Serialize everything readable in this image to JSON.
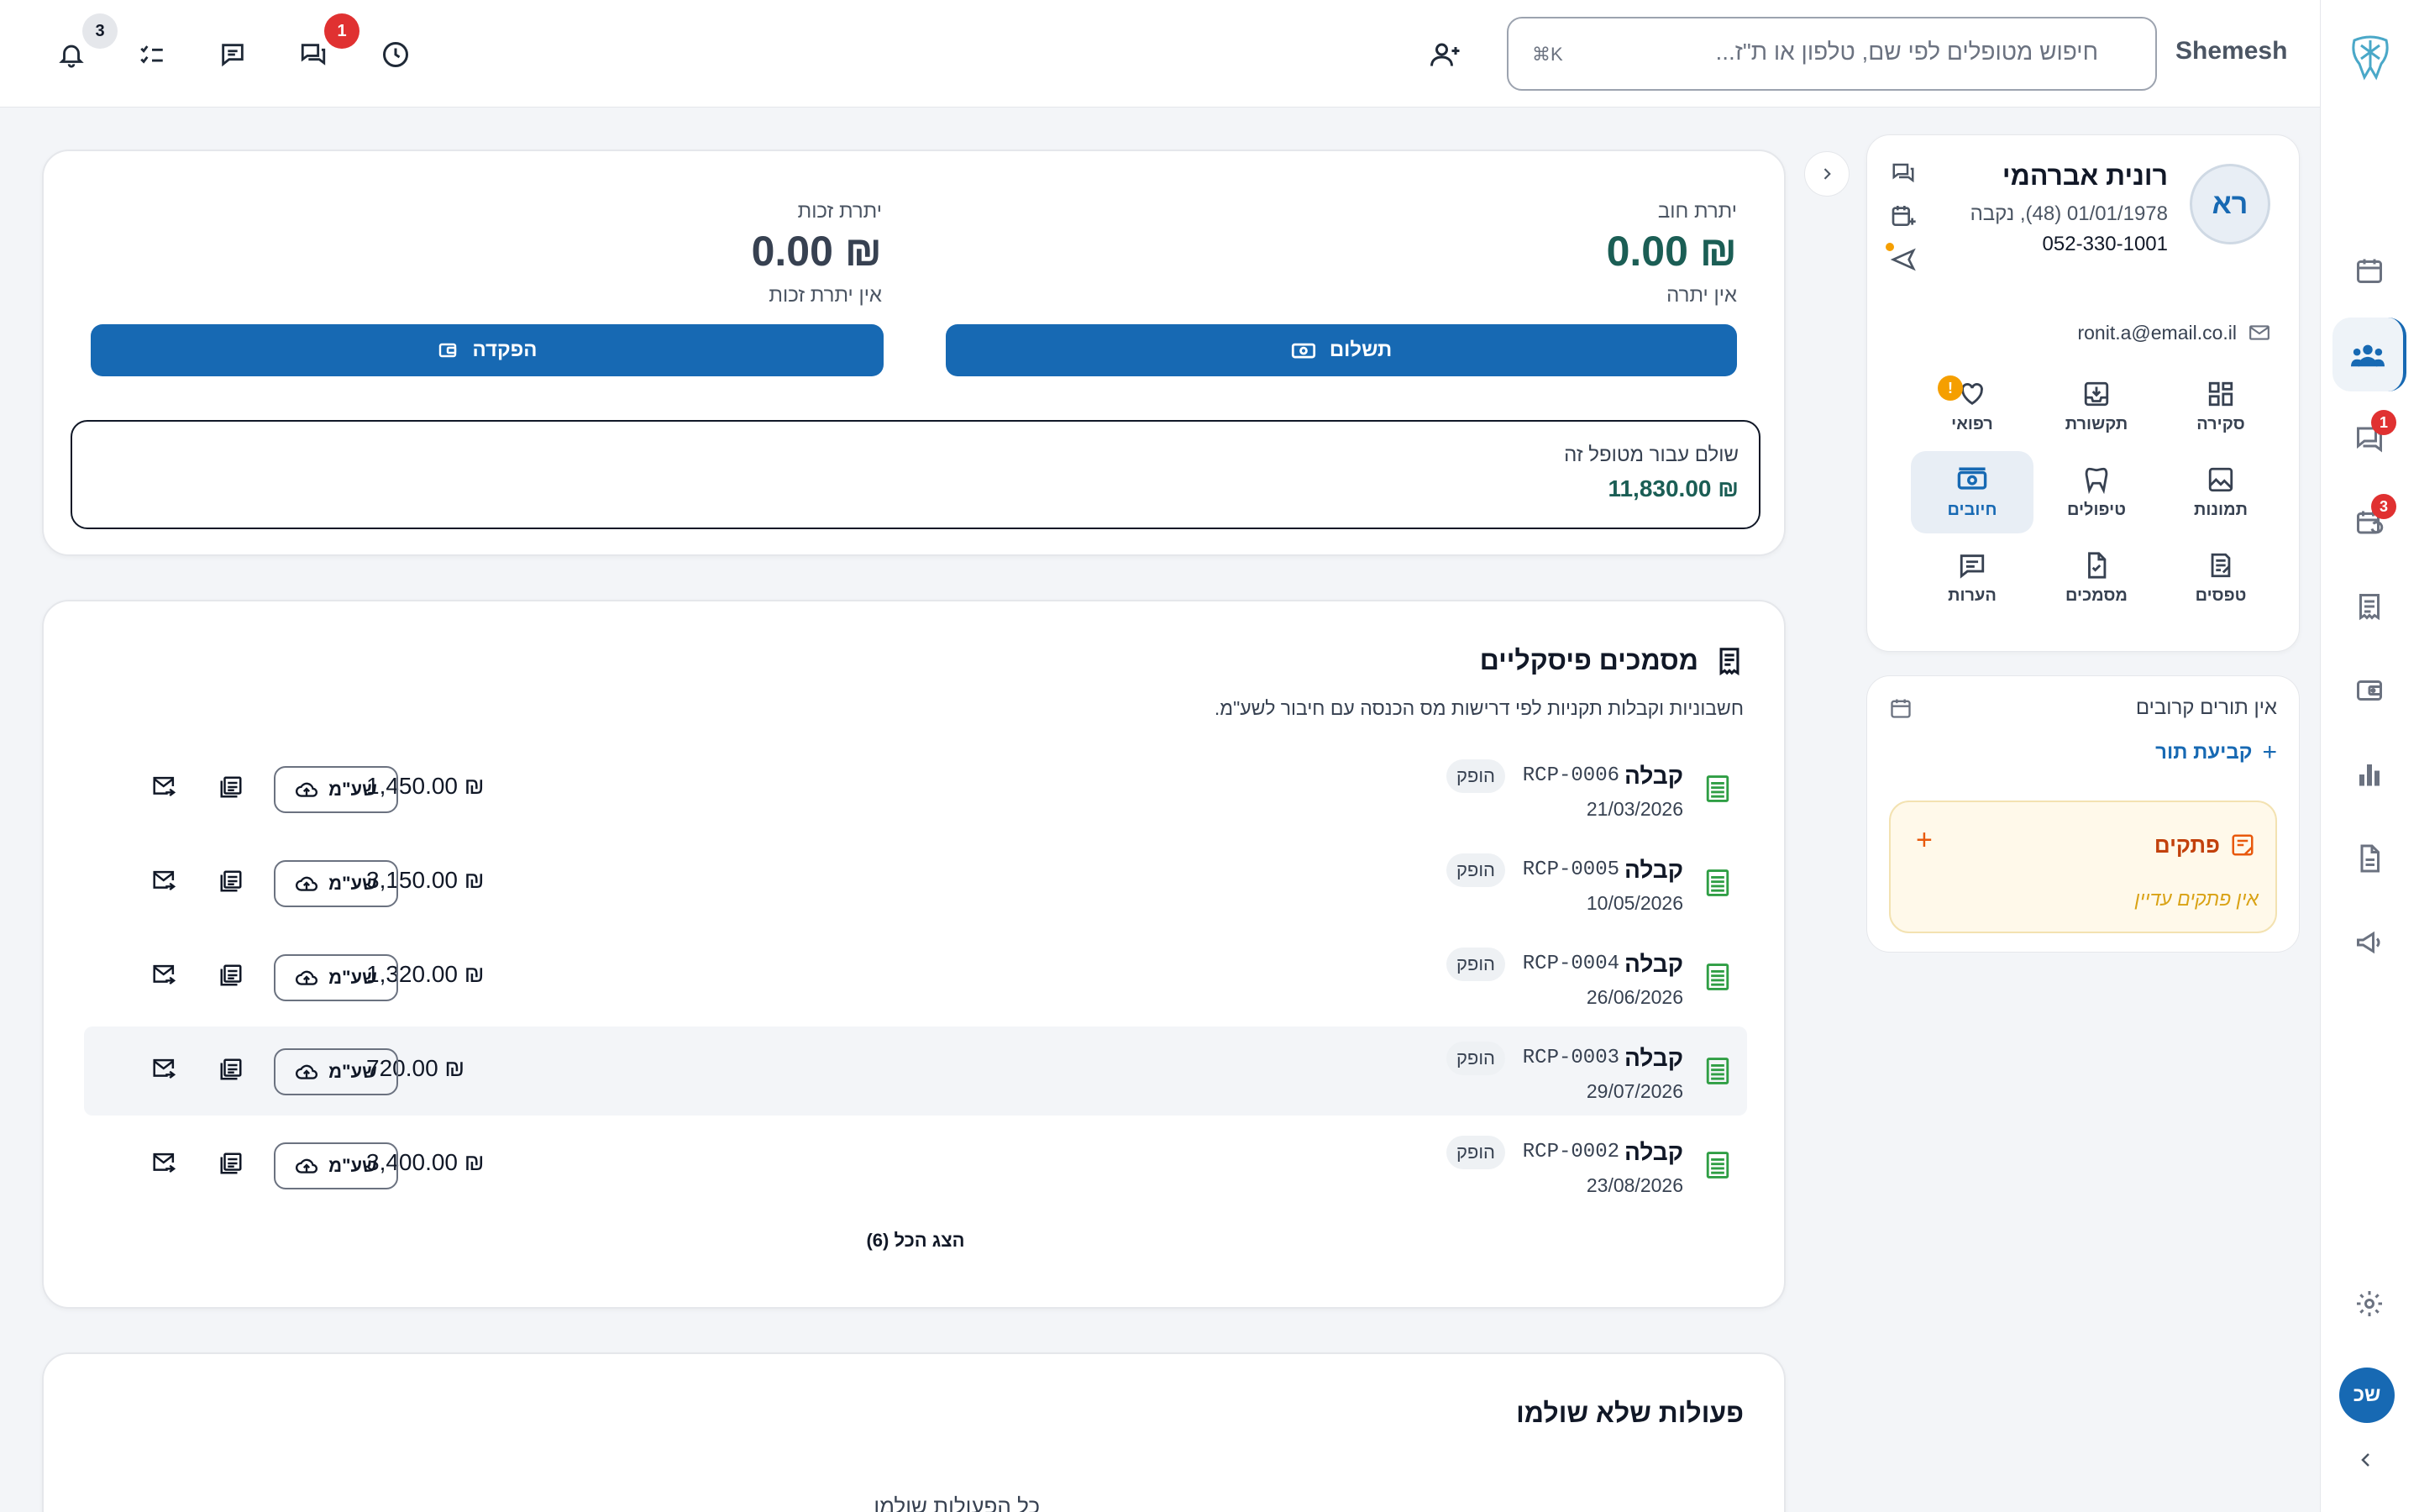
{
  "brand": {
    "name": "Shemesh"
  },
  "topbar": {
    "search_placeholder": "חיפוש מטופלים לפי שם, טלפון או ת\"ז...",
    "search_shortcut": "⌘K",
    "notifications_count": "3",
    "chat_count": "1"
  },
  "rail": {
    "messages_badge": "1",
    "recall_badge": "3",
    "user_initials": "שכ"
  },
  "patient": {
    "initials": "רא",
    "name": "רונית אברהמי",
    "details": "01/01/1978 (48), נקבה",
    "phone": "052-330-1001",
    "email": "ronit.a@email.co.il",
    "medical_alert": "!",
    "menu": [
      {
        "label": "סקירה"
      },
      {
        "label": "תקשורת"
      },
      {
        "label": "רפואי"
      },
      {
        "label": "תמונות"
      },
      {
        "label": "טיפולים"
      },
      {
        "label": "חיובים"
      },
      {
        "label": "טפסים"
      },
      {
        "label": "מסמכים"
      },
      {
        "label": "הערות"
      }
    ]
  },
  "appointments": {
    "empty_text": "אין תורים קרובים",
    "schedule_label": "קביעת תור",
    "notes_title": "פתקים",
    "notes_empty": "אין פתקים עדיין"
  },
  "balance": {
    "debt_label": "יתרת חוב",
    "debt_amount": "₪ 0.00",
    "debt_sub": "אין יתרה",
    "credit_label": "יתרת זכות",
    "credit_amount": "₪ 0.00",
    "credit_sub": "אין יתרת זכות",
    "pay_button": "תשלום",
    "deposit_button": "הפקדה",
    "paid_label": "שולם עבור מטופל זה",
    "paid_amount": "₪ 11,830.00"
  },
  "fiscal": {
    "title": "מסמכים פיסקליים",
    "subtitle": "חשבוניות וקבלות תקניות לפי דרישות מס הכנסה עם חיבור לשע\"מ.",
    "rows": [
      {
        "type": "קבלה",
        "number": "RCP-0006",
        "status": "הופק",
        "date": "21/03/2026",
        "amount": "₪ 1,450.00",
        "sync_label": "שע\"מ"
      },
      {
        "type": "קבלה",
        "number": "RCP-0005",
        "status": "הופק",
        "date": "10/05/2026",
        "amount": "₪ 3,150.00",
        "sync_label": "שע\"מ"
      },
      {
        "type": "קבלה",
        "number": "RCP-0004",
        "status": "הופק",
        "date": "26/06/2026",
        "amount": "₪ 1,320.00",
        "sync_label": "שע\"מ"
      },
      {
        "type": "קבלה",
        "number": "RCP-0003",
        "status": "הופק",
        "date": "29/07/2026",
        "amount": "₪ 720.00",
        "sync_label": "שע\"מ"
      },
      {
        "type": "קבלה",
        "number": "RCP-0002",
        "status": "הופק",
        "date": "23/08/2026",
        "amount": "₪ 3,400.00",
        "sync_label": "שע\"מ"
      }
    ],
    "show_all": "הצג הכל (6)"
  },
  "unpaid": {
    "title": "פעולות שלא שולמו",
    "empty_text": "כל הפעולות שולמו"
  },
  "colors": {
    "primary": "#1769b3",
    "success": "#2f9e44",
    "danger": "#e03131",
    "warning": "#f59f00",
    "notes_bg": "#fff9ea",
    "debt_amount": "#1b5e55"
  }
}
